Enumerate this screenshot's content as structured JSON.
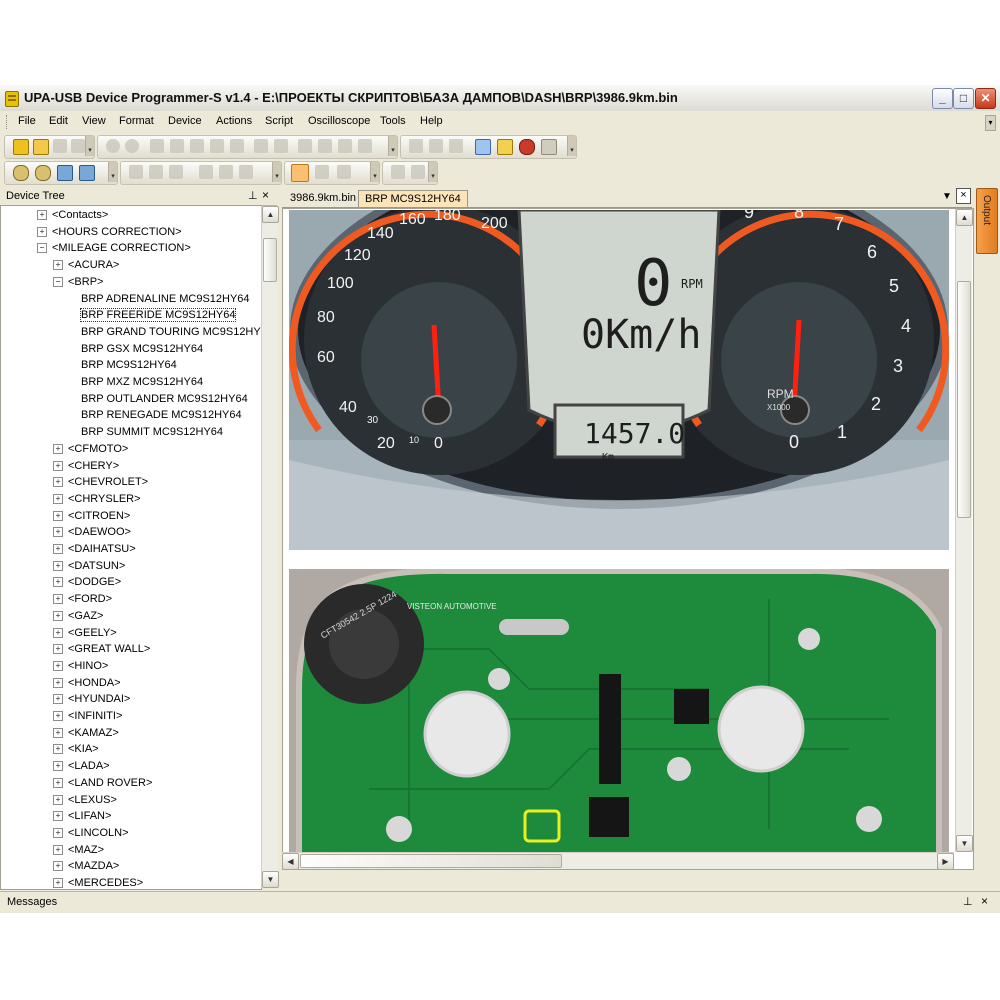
{
  "window": {
    "title": "UPA-USB Device Programmer-S v1.4 - E:\\ПРОЕКТЫ СКРИПТОВ\\БАЗА ДАМПОВ\\DASH\\BRP\\3986.9km.bin",
    "minimize": "_",
    "maximize": "□",
    "close": "✕"
  },
  "menu": [
    "File",
    "Edit",
    "View",
    "Format",
    "Device",
    "Actions",
    "Script",
    "Oscilloscope",
    "Tools",
    "Help"
  ],
  "device_tree": {
    "title": "Device Tree",
    "pin": "⊥",
    "close": "×",
    "items": [
      {
        "label": "<Contacts>",
        "sign": "+"
      },
      {
        "label": "<HOURS CORRECTION>",
        "sign": "+"
      },
      {
        "label": "<MILEAGE CORRECTION>",
        "sign": "−"
      },
      {
        "label": "<ACURA>",
        "sign": "+"
      },
      {
        "label": "<BRP>",
        "sign": "−"
      },
      {
        "label": "BRP ADRENALINE MC9S12HY64",
        "sign": ""
      },
      {
        "label": "BRP FREERIDE MC9S12HY64",
        "sign": "",
        "selected": true
      },
      {
        "label": "BRP GRAND TOURING MC9S12HY64",
        "sign": ""
      },
      {
        "label": "BRP GSX MC9S12HY64",
        "sign": ""
      },
      {
        "label": "BRP MC9S12HY64",
        "sign": ""
      },
      {
        "label": "BRP MXZ MC9S12HY64",
        "sign": ""
      },
      {
        "label": "BRP OUTLANDER MC9S12HY64",
        "sign": ""
      },
      {
        "label": "BRP RENEGADE MC9S12HY64",
        "sign": ""
      },
      {
        "label": "BRP SUMMIT MC9S12HY64",
        "sign": ""
      },
      {
        "label": "<CFMOTO>",
        "sign": "+"
      },
      {
        "label": "<CHERY>",
        "sign": "+"
      },
      {
        "label": "<CHEVROLET>",
        "sign": "+"
      },
      {
        "label": "<CHRYSLER>",
        "sign": "+"
      },
      {
        "label": "<CITROEN>",
        "sign": "+"
      },
      {
        "label": "<DAEWOO>",
        "sign": "+"
      },
      {
        "label": "<DAIHATSU>",
        "sign": "+"
      },
      {
        "label": "<DATSUN>",
        "sign": "+"
      },
      {
        "label": "<DODGE>",
        "sign": "+"
      },
      {
        "label": "<FORD>",
        "sign": "+"
      },
      {
        "label": "<GAZ>",
        "sign": "+"
      },
      {
        "label": "<GEELY>",
        "sign": "+"
      },
      {
        "label": "<GREAT WALL>",
        "sign": "+"
      },
      {
        "label": "<HINO>",
        "sign": "+"
      },
      {
        "label": "<HONDA>",
        "sign": "+"
      },
      {
        "label": "<HYUNDAI>",
        "sign": "+"
      },
      {
        "label": "<INFINITI>",
        "sign": "+"
      },
      {
        "label": "<KAMAZ>",
        "sign": "+"
      },
      {
        "label": "<KIA>",
        "sign": "+"
      },
      {
        "label": "<LADA>",
        "sign": "+"
      },
      {
        "label": "<LAND ROVER>",
        "sign": "+"
      },
      {
        "label": "<LEXUS>",
        "sign": "+"
      },
      {
        "label": "<LIFAN>",
        "sign": "+"
      },
      {
        "label": "<LINCOLN>",
        "sign": "+"
      },
      {
        "label": "<MAZ>",
        "sign": "+"
      },
      {
        "label": "<MAZDA>",
        "sign": "+"
      },
      {
        "label": "<MERCEDES>",
        "sign": "+"
      }
    ]
  },
  "tabs": [
    {
      "label": "3986.9km.bin",
      "active": false
    },
    {
      "label": "BRP MC9S12HY64",
      "active": true
    }
  ],
  "dashboard": {
    "speed_ticks": [
      "0",
      "10",
      "20",
      "30",
      "40",
      "60",
      "80",
      "100",
      "120",
      "140",
      "160",
      "180",
      "200"
    ],
    "rpm_ticks": [
      "0",
      "1",
      "2",
      "3",
      "4",
      "5",
      "6",
      "7",
      "8",
      "9"
    ],
    "speed_readout": "0",
    "speed_unit": "0Km/h",
    "rpm_unit": "RPM",
    "rpm_label": "RPM",
    "rpm_multiplier": "X1000",
    "odometer": "1457.0",
    "odometer_unit": "Km"
  },
  "board": {
    "maker": "VISTEON AUTOMOTIVE",
    "buzzer": "CFT30542 2.5P 1224"
  },
  "output_tab": "Output",
  "messages": {
    "title": "Messages",
    "pin": "⊥",
    "close": "×"
  }
}
